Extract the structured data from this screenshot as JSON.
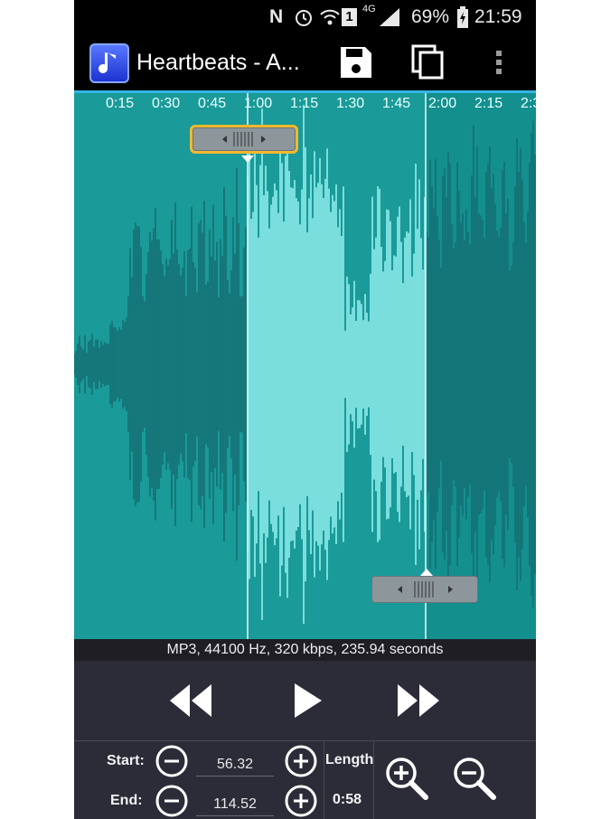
{
  "status_bar": {
    "battery": "69%",
    "time": "21:59",
    "network": "4G",
    "sim": "1",
    "icons": [
      "nfc-icon",
      "alarm-icon",
      "wifi-icon",
      "sim-icon",
      "signal-icon",
      "battery-icon"
    ]
  },
  "action_bar": {
    "title": "Heartbeats - A...",
    "icons": [
      "app-music-icon",
      "save-icon",
      "copy-icon",
      "overflow-menu-icon"
    ]
  },
  "waveform": {
    "timeline": [
      "0:15",
      "0:30",
      "0:45",
      "1:00",
      "1:15",
      "1:30",
      "1:45",
      "2:00",
      "2:15",
      "2:3"
    ],
    "selection_start_seconds": 56.32,
    "selection_end_seconds": 114.52,
    "colors": {
      "background": "#1a9a98",
      "selected_waveform": "#9ff9f7",
      "unselected_waveform": "#156f73",
      "handle_active_border": "#f5b82e"
    }
  },
  "info": {
    "text": "MP3, 44100 Hz, 320 kbps, 235.94 seconds"
  },
  "transport": {
    "icons": [
      "rewind-icon",
      "play-icon",
      "fast-forward-icon"
    ]
  },
  "controls": {
    "start_label": "Start:",
    "start_value": "56.32",
    "end_label": "End:",
    "end_value": "114.52",
    "length_label": "Length",
    "length_value": "0:58",
    "icons": [
      "minus-icon",
      "plus-icon",
      "zoom-in-icon",
      "zoom-out-icon"
    ]
  }
}
